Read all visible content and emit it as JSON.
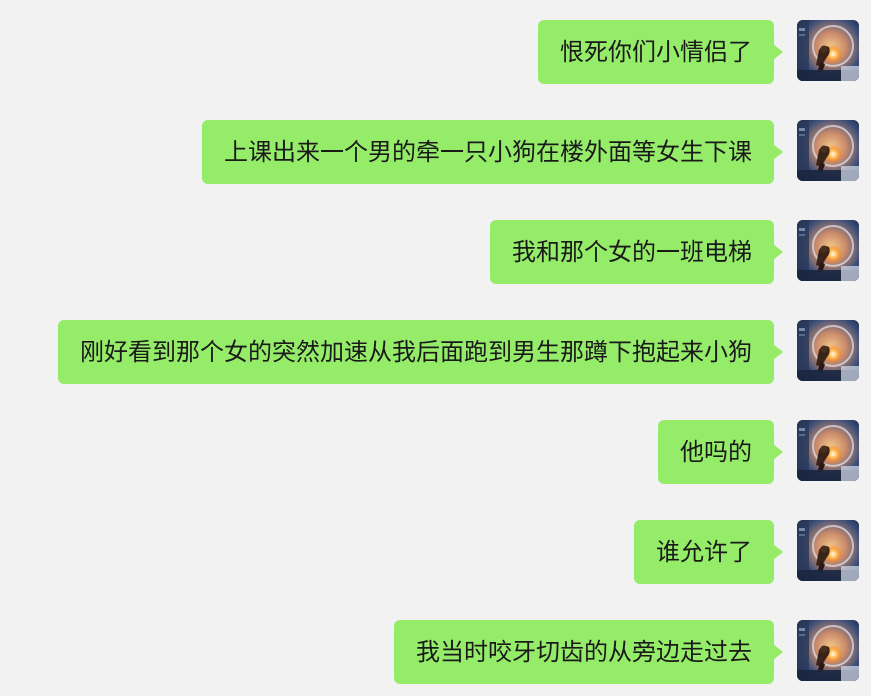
{
  "messages": [
    {
      "text": "恨死你们小情侣了",
      "sender": "self",
      "avatar_icon": "astronaut-moon-avatar-icon"
    },
    {
      "text": "上课出来一个男的牵一只小狗在楼外面等女生下课",
      "sender": "self",
      "avatar_icon": "astronaut-moon-avatar-icon"
    },
    {
      "text": "我和那个女的一班电梯",
      "sender": "self",
      "avatar_icon": "astronaut-moon-avatar-icon"
    },
    {
      "text": "刚好看到那个女的突然加速从我后面跑到男生那蹲下抱起来小狗",
      "sender": "self",
      "avatar_icon": "astronaut-moon-avatar-icon"
    },
    {
      "text": "他吗的",
      "sender": "self",
      "avatar_icon": "astronaut-moon-avatar-icon"
    },
    {
      "text": "谁允许了",
      "sender": "self",
      "avatar_icon": "astronaut-moon-avatar-icon"
    },
    {
      "text": "我当时咬牙切齿的从旁边走过去",
      "sender": "self",
      "avatar_icon": "astronaut-moon-avatar-icon"
    }
  ],
  "colors": {
    "background": "#f2f2f2",
    "bubble": "#95ec69",
    "text": "#1a1a1a"
  }
}
